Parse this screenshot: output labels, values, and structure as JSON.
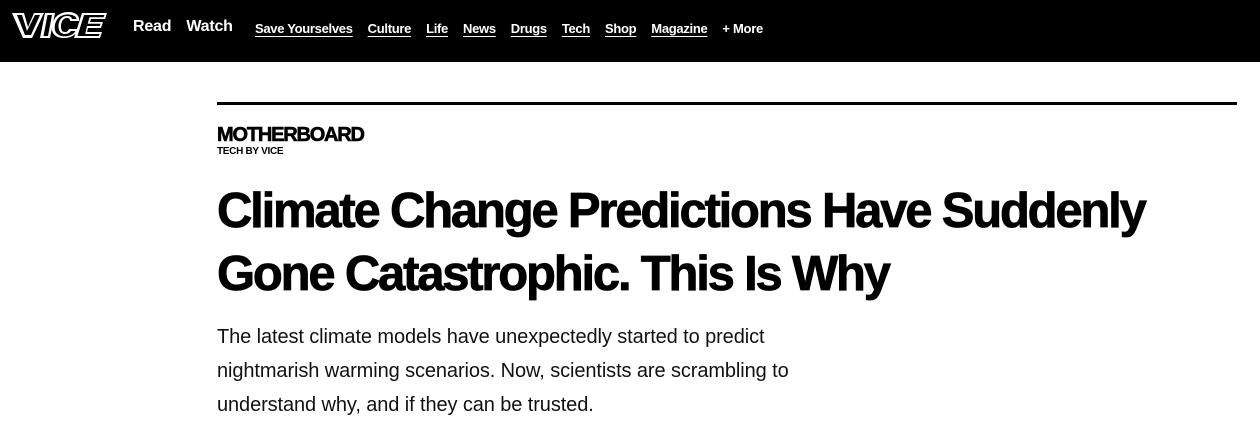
{
  "header": {
    "logo_text": "VICE",
    "primary_nav": [
      "Read",
      "Watch"
    ],
    "secondary_nav": [
      "Save Yourselves",
      "Culture",
      "Life",
      "News",
      "Drugs",
      "Tech",
      "Shop",
      "Magazine"
    ],
    "more_label": "+ More"
  },
  "article": {
    "brand": "MOTHERBOARD",
    "tagline": "TECH BY VICE",
    "headline": "Climate Change Predictions Have Suddenly Gone Catastrophic. This Is Why",
    "dek": "The latest climate models have unexpectedly started to predict nightmarish warming scenarios. Now, scientists are scrambling to understand why, and if they can be trusted."
  },
  "colors": {
    "topbar_bg": "#000000",
    "topbar_text": "#ffffff",
    "page_bg": "#ffffff",
    "text": "#000000"
  }
}
